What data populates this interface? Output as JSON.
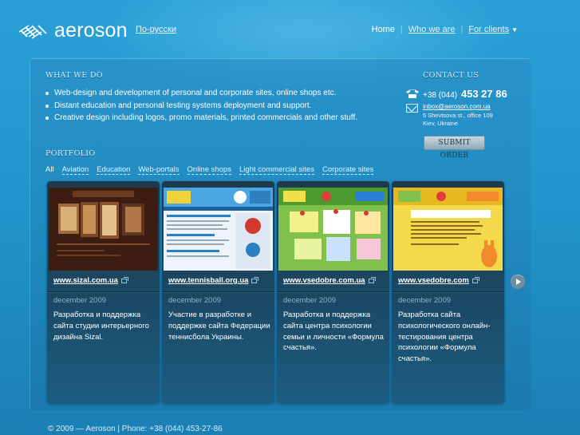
{
  "brand": {
    "name": "aeroson"
  },
  "header": {
    "lang_link": "По-русски",
    "nav": [
      {
        "label": "Home"
      },
      {
        "label": "Who we are"
      },
      {
        "label": "For clients"
      }
    ]
  },
  "what_we_do": {
    "title": "WHAT WE DO",
    "items": [
      "Web-design and development of personal and corporate sites, online shops etc.",
      "Distant education and personal testing systems deployment and support.",
      "Creative design including logos, promo materials, printed commercials and other stuff."
    ]
  },
  "contact": {
    "title": "CONTACT US",
    "phone_prefix": "+38 (044)",
    "phone_number": "453 27 86",
    "email": "inbox@aeroson.com.ua",
    "address_line1": "5 Shevtsova st., office 109",
    "address_line2": "Kiev, Ukraine",
    "submit_label": "SUBMIT ORDER"
  },
  "portfolio": {
    "title": "PORTFOLIO",
    "filters": [
      "All",
      "Aviation",
      "Education",
      "Web-portals",
      "Online shops",
      "Light commercial sites",
      "Corporate sites"
    ],
    "cards": [
      {
        "link": "www.sizal.com.ua",
        "date": "december 2009",
        "desc": "Разработка и поддержка сайта студии интерьерного дизайна Sizal."
      },
      {
        "link": "www.tennisball.org.ua",
        "date": "december 2009",
        "desc": "Участие в разработке и поддержке сайта Федерации теннисбола Украины."
      },
      {
        "link": "www.vsedobre.com.ua",
        "date": "december 2009",
        "desc": "Разработка и поддержка сайта центра психологии семьи и личности «Формула счастья»."
      },
      {
        "link": "www.vsedobre.com",
        "date": "december 2009",
        "desc": "Разработка сайта психологического онлайн-тестирования центра психологии «Формула счастья»."
      }
    ]
  },
  "footer": {
    "text": "© 2009 — Aeroson | Phone: +38 (044) 453-27-86"
  },
  "colors": {
    "background": "#2196cc",
    "card": "#1b4a66",
    "button": "#a9bfcb"
  }
}
